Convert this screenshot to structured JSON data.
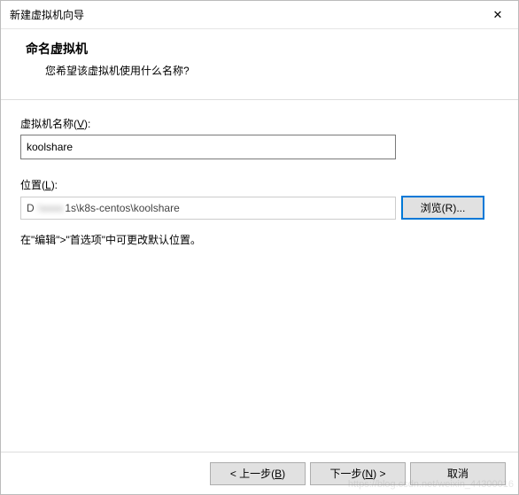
{
  "titlebar": {
    "title": "新建虚拟机向导",
    "close_glyph": "✕"
  },
  "header": {
    "title": "命名虚拟机",
    "subtitle": "您希望该虚拟机使用什么名称?"
  },
  "fields": {
    "name_label_prefix": "虚拟机名称(",
    "name_label_hotkey": "V",
    "name_label_suffix": "):",
    "name_value": "koolshare",
    "location_label_prefix": "位置(",
    "location_label_hotkey": "L",
    "location_label_suffix": "):",
    "location_prefix": "D",
    "location_blurred": ":\\xxxx",
    "location_suffix": "1s\\k8s-centos\\koolshare",
    "browse_prefix": "浏览(",
    "browse_hotkey": "R",
    "browse_suffix": ")..."
  },
  "hint": "在\"编辑\">\"首选项\"中可更改默认位置。",
  "buttons": {
    "back_prefix": "< 上一步(",
    "back_hotkey": "B",
    "back_suffix": ")",
    "next_prefix": "下一步(",
    "next_hotkey": "N",
    "next_suffix": ") >",
    "cancel": "取消"
  },
  "watermark": "https://blog.csdn.net/weixin_44300016"
}
